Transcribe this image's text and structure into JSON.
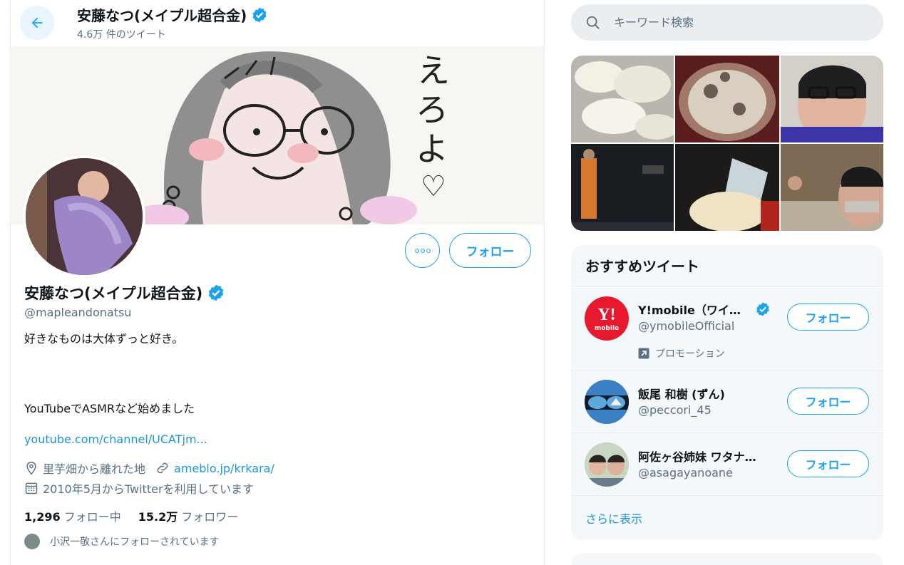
{
  "header": {
    "display_name": "安藤なつ(メイプル超合金)",
    "tweet_count": "4.6万 件のツイート"
  },
  "profile": {
    "display_name": "安藤なつ(メイプル超合金)",
    "handle": "@mapleandonatsu",
    "bio_line1": "好きなものは大体ずっと好き。",
    "bio_line2": "YouTubeでASMRなど始めました",
    "bio_link": "youtube.com/channel/UCATjm...",
    "location": "里芋畑から離れた地",
    "website": "ameblo.jp/krkara/",
    "joined": "2010年5月からTwitterを利用しています",
    "following_count": "1,296",
    "following_label": "フォロー中",
    "followers_count": "15.2万",
    "followers_label": "フォロワー",
    "followed_by": "小沢一敬さんにフォローされています",
    "follow_label": "フォロー"
  },
  "banner": {
    "handwriting": "えろよ♡"
  },
  "search": {
    "placeholder": "キーワード検索"
  },
  "recommendations": {
    "title": "おすすめツイート",
    "items": [
      {
        "name": "Y!mobile（ワイ…",
        "handle": "@ymobileOfficial",
        "verified": true,
        "promo": "プロモーション",
        "follow": "フォロー",
        "avatar_text": "Y!",
        "avatar_sub": "mobile"
      },
      {
        "name": "飯尾 和樹 (ずん)",
        "handle": "@peccori_45",
        "follow": "フォロー"
      },
      {
        "name": "阿佐ヶ谷姉妹 ワタナ…",
        "handle": "@asagayanoane",
        "follow": "フォロー"
      }
    ],
    "show_more": "さらに表示"
  },
  "colors": {
    "accent": "#1da1f2",
    "link": "#1b95e0",
    "secondary_text": "#5b7083",
    "verified": "#1da1f2"
  }
}
